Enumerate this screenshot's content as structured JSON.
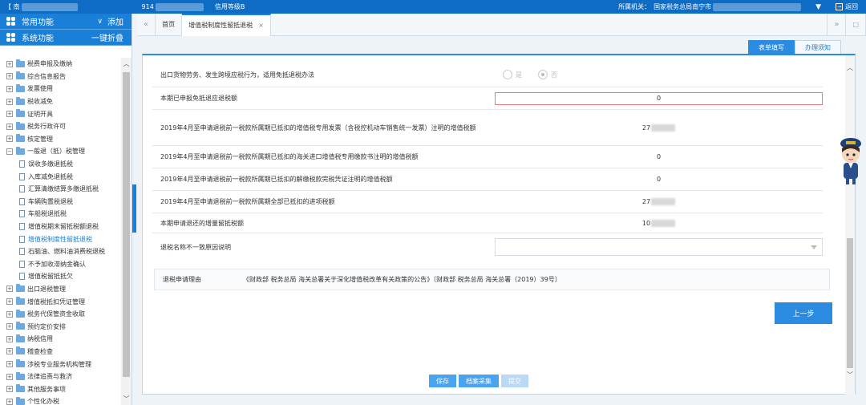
{
  "topbar": {
    "org_prefix": "【 南",
    "taxpayer_id_prefix": "914",
    "credit_rating": "信用等级B",
    "authority_label": "所属机关：",
    "authority_value": "国家税务总局南宁市",
    "return_label": "返回"
  },
  "sidebar": {
    "common_title": "常用功能",
    "common_action": "添加",
    "system_title": "系统功能",
    "system_action": "一键折叠",
    "items": [
      {
        "label": "税费申报及缴纳",
        "type": "folder"
      },
      {
        "label": "综合信息报告",
        "type": "folder"
      },
      {
        "label": "发票使用",
        "type": "folder"
      },
      {
        "label": "税收减免",
        "type": "folder"
      },
      {
        "label": "证明开具",
        "type": "folder"
      },
      {
        "label": "税务行政许可",
        "type": "folder"
      },
      {
        "label": "核定管理",
        "type": "folder"
      },
      {
        "label": "一般退（抵）税管理",
        "type": "folder-open"
      },
      {
        "label": "误收多缴退抵税",
        "type": "doc"
      },
      {
        "label": "入库减免退抵税",
        "type": "doc"
      },
      {
        "label": "汇算清缴结算多缴退抵税",
        "type": "doc"
      },
      {
        "label": "车辆购置税退税",
        "type": "doc"
      },
      {
        "label": "车船税退抵税",
        "type": "doc"
      },
      {
        "label": "增值税期末留抵税额退税",
        "type": "doc"
      },
      {
        "label": "增值税制度性留抵退税",
        "type": "doc",
        "active": true
      },
      {
        "label": "石脑油、燃料油消费税退税",
        "type": "doc"
      },
      {
        "label": "不予加收滞纳金确认",
        "type": "doc"
      },
      {
        "label": "增值税留抵抵欠",
        "type": "doc"
      },
      {
        "label": "出口退税管理",
        "type": "folder"
      },
      {
        "label": "增值税抵扣凭证管理",
        "type": "folder"
      },
      {
        "label": "税务代保管资金收取",
        "type": "folder"
      },
      {
        "label": "预约定价安排",
        "type": "folder"
      },
      {
        "label": "纳税信用",
        "type": "folder"
      },
      {
        "label": "稽查检查",
        "type": "folder"
      },
      {
        "label": "涉税专业服务机构管理",
        "type": "folder"
      },
      {
        "label": "法律追责与救济",
        "type": "folder"
      },
      {
        "label": "其他服务事项",
        "type": "folder"
      },
      {
        "label": "个性化办税",
        "type": "folder"
      }
    ]
  },
  "tabs": [
    {
      "label": "首页"
    },
    {
      "label": "增值税制度性留抵退税",
      "active": true
    }
  ],
  "subtabs": {
    "fill": "表单填写",
    "notice": "办理须知"
  },
  "form": {
    "rows": [
      {
        "label": "出口货物劳务、发生跨境应税行为，适用免抵退税办法",
        "kind": "radio",
        "yes": "是",
        "no": "否"
      },
      {
        "label": "本期已申报免抵退应退税额",
        "kind": "input",
        "value": "0"
      },
      {
        "label": "2019年4月至申请退税前一税款所属期已抵扣的增值税专用发票（含税控机动车销售统一发票）注明的增值税额",
        "kind": "value",
        "value": "27",
        "masked": true
      },
      {
        "label": "2019年4月至申请退税前一税款所属期已抵扣的海关进口增值税专用缴款书注明的增值税额",
        "kind": "value",
        "value": "0"
      },
      {
        "label": "2019年4月至申请退税前一税款所属期已抵扣的解缴税款完税凭证注明的增值税额",
        "kind": "value",
        "value": "0"
      },
      {
        "label": "2019年4月至申请退税前一税款所属期全部已抵扣的进项税额",
        "kind": "value",
        "value": "27",
        "masked": true
      },
      {
        "label": "本期申请退还的增量留抵税额",
        "kind": "value",
        "value": "10",
        "masked": true
      },
      {
        "label": "退税名称不一致原因说明",
        "kind": "select",
        "value": ""
      }
    ],
    "reason_label": "退税申请理由",
    "reason_value": "《财政部 税务总局 海关总署关于深化增值税改革有关政策的公告》〔财政部 税务总局 海关总署（2019）39号〕",
    "prev_button": "上一步"
  },
  "bottom_buttons": {
    "save": "保存",
    "archive": "档案采集",
    "submit": "提交"
  },
  "colors": {
    "primary": "#1a7fd6",
    "topbar": "#0f6cc4",
    "error_border": "#e87a7a"
  }
}
